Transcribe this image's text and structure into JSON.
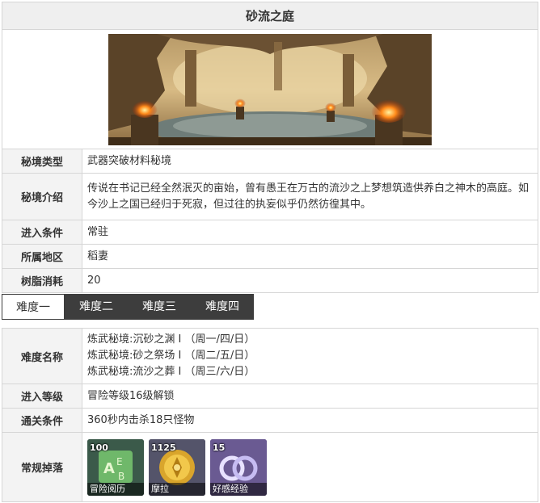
{
  "title": "砂流之庭",
  "info_rows": [
    {
      "label": "秘境类型",
      "value": "武器突破材料秘境"
    },
    {
      "label": "秘境介绍",
      "value": "传说在书记已经全然泯灭的亩始，曾有愚王在万古的流沙之上梦想筑造供养白之神木的高庭。如今沙上之国已经归于死寂，但过往的执妄似乎仍然彷徨其中。"
    },
    {
      "label": "进入条件",
      "value": "常驻"
    },
    {
      "label": "所属地区",
      "value": "稻妻"
    },
    {
      "label": "树脂消耗",
      "value": "20"
    }
  ],
  "tabs": [
    "难度一",
    "难度二",
    "难度三",
    "难度四"
  ],
  "active_tab": 0,
  "difficulty": {
    "name_label": "难度名称",
    "names": [
      "炼武秘境:沉砂之渊 Ⅰ （周一/四/日）",
      "炼武秘境:砂之祭场 Ⅰ （周二/五/日）",
      "炼武秘境:流沙之葬 Ⅰ （周三/六/日）"
    ],
    "level_label": "进入等级",
    "level_value": "冒险等级16级解锁",
    "clear_label": "通关条件",
    "clear_value": "360秒内击杀18只怪物",
    "drops_label": "常规掉落",
    "drops": [
      {
        "qty": "100",
        "name": "冒险阅历",
        "icon": "adventure-exp-icon"
      },
      {
        "qty": "1125",
        "name": "摩拉",
        "icon": "mora-coin-icon"
      },
      {
        "qty": "15",
        "name": "好感经验",
        "icon": "friendship-exp-icon"
      }
    ]
  },
  "colors": {
    "tab_bg": "#3d3d3d",
    "label_bg": "#f3f3f3",
    "border": "#d6d6d6"
  }
}
